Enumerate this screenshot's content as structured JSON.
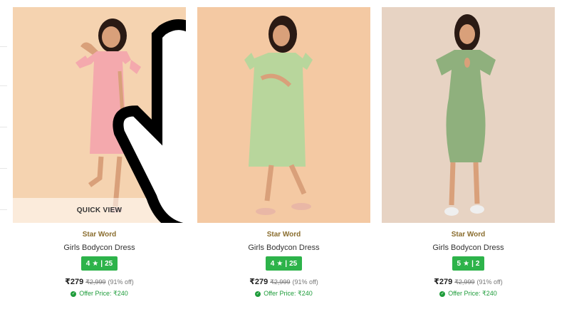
{
  "products": [
    {
      "brand": "Star Word",
      "name": "Girls Bodycon Dress",
      "rating": "4",
      "star": "★",
      "sep": "|",
      "reviews": "25",
      "price": "₹279",
      "mrp": "₹2,999",
      "discount": "(91% off)",
      "offer": "Offer Price: ₹240",
      "quick_view": "QUICK VIEW",
      "bg_color": "#f5d3b0",
      "dress_color": "#f4a9ad"
    },
    {
      "brand": "Star Word",
      "name": "Girls Bodycon Dress",
      "rating": "4",
      "star": "★",
      "sep": "|",
      "reviews": "25",
      "price": "₹279",
      "mrp": "₹2,999",
      "discount": "(91% off)",
      "offer": "Offer Price: ₹240",
      "bg_color": "#f4c9a3",
      "dress_color": "#b8d69c"
    },
    {
      "brand": "Star Word",
      "name": "Girls Bodycon Dress",
      "rating": "5",
      "star": "★",
      "sep": "|",
      "reviews": "2",
      "price": "₹279",
      "mrp": "₹2,999",
      "discount": "(91% off)",
      "offer": "Offer Price: ₹240",
      "bg_color": "#e7d3c3",
      "dress_color": "#8fb07d"
    }
  ],
  "colors": {
    "rating_green": "#2db34a",
    "brand_gold": "#8a6d2e",
    "offer_green": "#1e9c3a"
  },
  "icons": {
    "cursor": "hand-pointer-icon",
    "offer": "check-circle-icon"
  }
}
